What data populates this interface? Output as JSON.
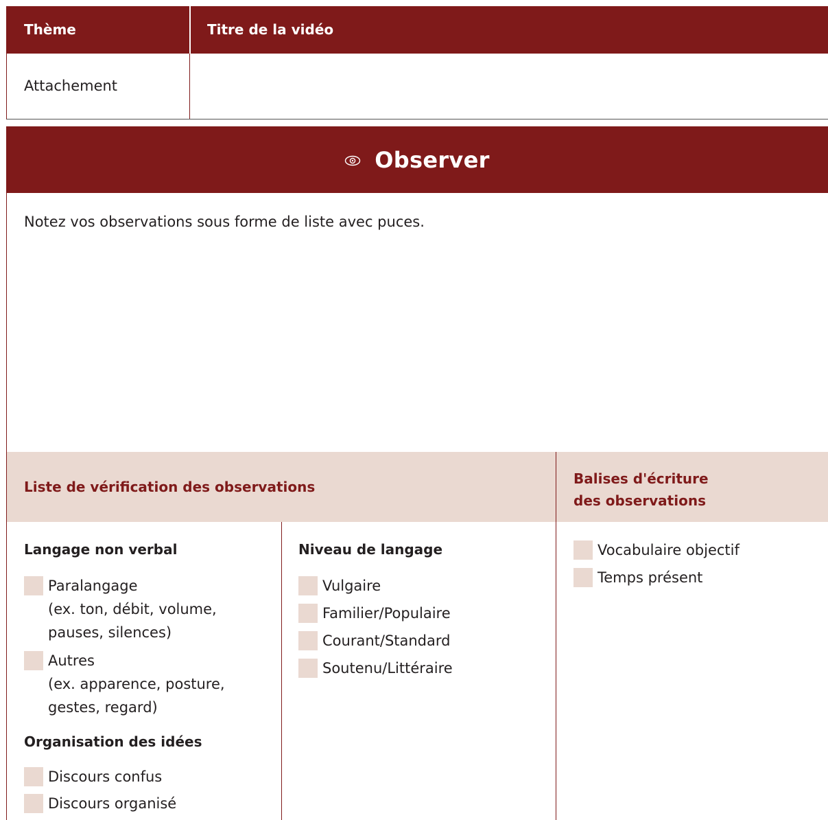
{
  "top_table": {
    "headers": {
      "theme": "Thème",
      "title": "Titre de la vidéo"
    },
    "row": {
      "theme": "Attachement",
      "title": ""
    }
  },
  "banner": {
    "icon": "eye-icon",
    "title": "Observer"
  },
  "instructions": "Notez vos observations sous forme de liste avec puces.",
  "checklist": {
    "title": "Liste de vérification des observations",
    "balises_title_line1": "Balises d'écriture",
    "balises_title_line2": "des observations",
    "col1": {
      "group1_title": "Langage non verbal",
      "group1_items": [
        {
          "label": "Paralangage",
          "sub1": "(ex. ton, débit, volume,",
          "sub2": "pauses, silences)"
        },
        {
          "label": "Autres",
          "sub1": "(ex. apparence, posture,",
          "sub2": "gestes, regard)"
        }
      ],
      "group2_title": "Organisation des idées",
      "group2_items": [
        "Discours confus",
        "Discours organisé"
      ]
    },
    "col2": {
      "group_title": "Niveau de langage",
      "items": [
        "Vulgaire",
        "Familier/Populaire",
        "Courant/Standard",
        "Soutenu/Littéraire"
      ]
    },
    "col3": {
      "items": [
        "Vocabulaire objectif",
        "Temps présent"
      ]
    }
  },
  "colors": {
    "accent": "#7f1a1a",
    "light_fill": "#ead9d1",
    "text": "#231f20"
  }
}
